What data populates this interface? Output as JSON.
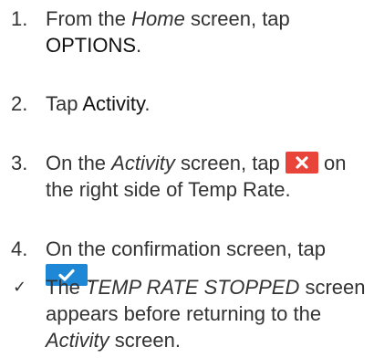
{
  "steps": [
    {
      "number": "1.",
      "prefix": "From the ",
      "screen": "Home",
      "middle": " screen, tap ",
      "action": "OPTIONS",
      "suffix": "."
    },
    {
      "number": "2.",
      "prefix": "Tap ",
      "action": "Activity",
      "suffix": "."
    },
    {
      "number": "3.",
      "prefix": "On the ",
      "screen": "Activity",
      "middle": " screen, tap ",
      "after_icon": " on the right side of Temp Rate.",
      "icon": "stop-x-icon"
    },
    {
      "number": "4.",
      "prefix": "On the confirmation screen, tap",
      "icon": "confirm-check-icon",
      "suffix": "."
    }
  ],
  "result": {
    "marker": "✓",
    "prefix": "The ",
    "screen": "TEMP RATE STOPPED",
    "middle": " screen appears before returning to the ",
    "screen2": "Activity",
    "suffix": " screen."
  },
  "colors": {
    "text": "#333333",
    "stop_button": "#e8443a",
    "confirm_button": "#1e88d6"
  }
}
